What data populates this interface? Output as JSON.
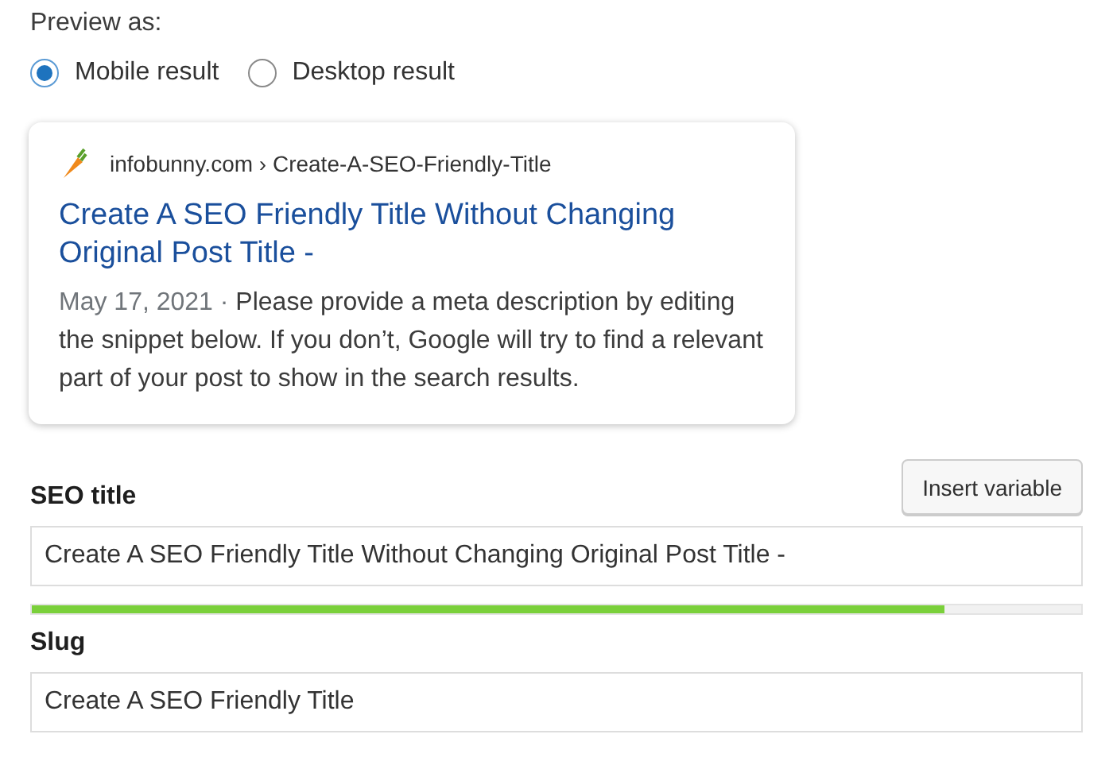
{
  "preview_label": "Preview as:",
  "preview_options": [
    {
      "label": "Mobile result",
      "selected": true
    },
    {
      "label": "Desktop result",
      "selected": false
    }
  ],
  "snippet": {
    "breadcrumb": "infobunny.com › Create-A-SEO-Friendly-Title",
    "title": "Create A SEO Friendly Title Without Changing Original Post Title -",
    "date": "May 17, 2021 · ",
    "description": "Please provide a meta description by editing the snippet below. If you don’t, Google will try to find a relevant part of your post to show in the search results."
  },
  "seo_title": {
    "label": "SEO title",
    "button": "Insert variable",
    "value": "Create A SEO Friendly Title Without Changing Original Post Title -",
    "level": 0.87
  },
  "slug": {
    "label": "Slug",
    "value": "Create A SEO Friendly Title"
  }
}
